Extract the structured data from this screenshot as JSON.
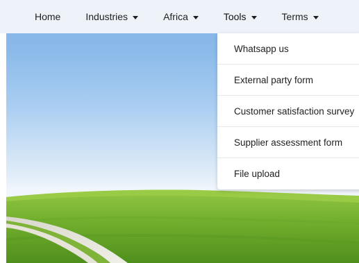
{
  "nav": {
    "items": [
      {
        "label": "Home",
        "has_dropdown": false
      },
      {
        "label": "Industries",
        "has_dropdown": true
      },
      {
        "label": "Africa",
        "has_dropdown": true
      },
      {
        "label": "Tools",
        "has_dropdown": true
      },
      {
        "label": "Terms",
        "has_dropdown": true
      }
    ],
    "caret_icon": "caret-down-icon",
    "background": "#eef3f9"
  },
  "tools_dropdown": {
    "items": [
      {
        "label": "Whatsapp us"
      },
      {
        "label": "External party form"
      },
      {
        "label": "Customer satisfaction survey"
      },
      {
        "label": "Supplier assessment form"
      },
      {
        "label": "File upload"
      }
    ]
  },
  "hero": {
    "description_colors": {
      "sky": "#8cbbea",
      "grass": "#6aa82b",
      "path": "#e9e6dc"
    }
  }
}
